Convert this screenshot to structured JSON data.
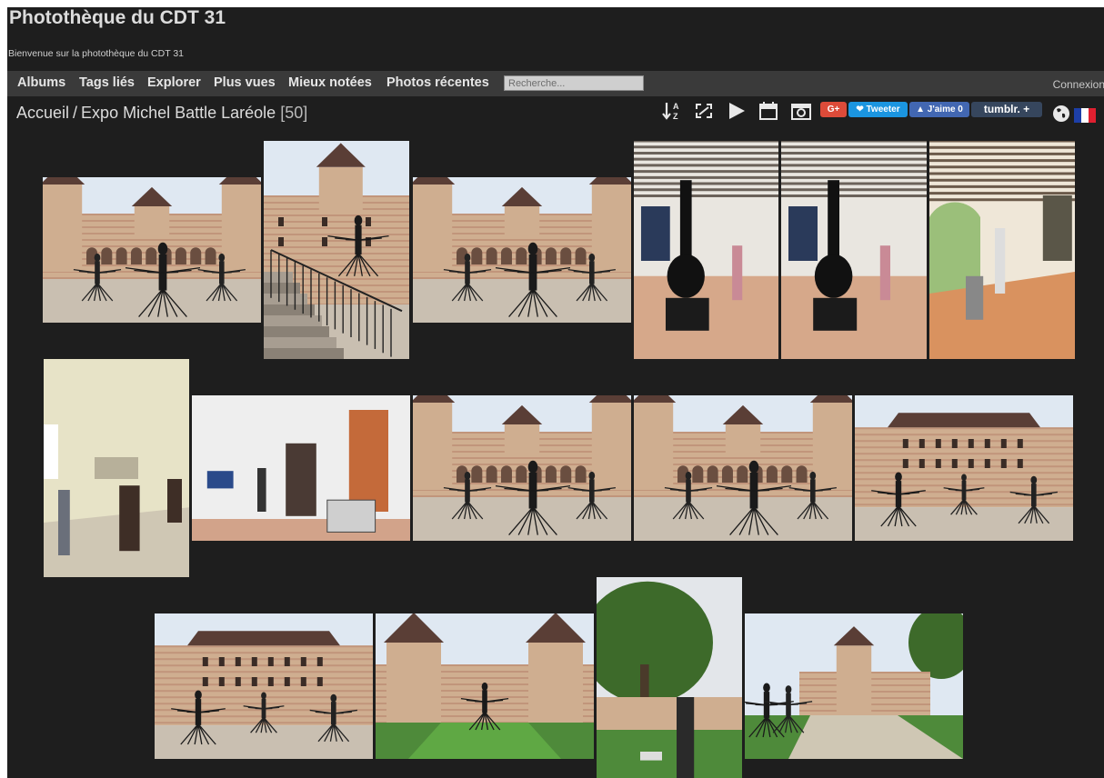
{
  "site": {
    "title": "Photothèque du CDT 31",
    "subtitle": "Bienvenue sur la photothèque du CDT 31"
  },
  "menu": {
    "items": [
      "Albums",
      "Tags liés",
      "Explorer",
      "Plus vues",
      "Mieux notées",
      "Photos récentes"
    ],
    "search_placeholder": "Recherche...",
    "login": "Connexion"
  },
  "breadcrumb": {
    "home": "Accueil",
    "separator": "/",
    "album": "Expo Michel Battle Laréole",
    "count": "[50]"
  },
  "toolbar": {
    "icons": [
      "sort-az-icon",
      "fullscreen-icon",
      "slideshow-play-icon",
      "calendar-icon",
      "camera-icon"
    ],
    "gplus_label": "G+",
    "tweet_label": "Tweeter",
    "like_label": "J'aime 0",
    "tumblr_label": "tumblr. +",
    "language": "Français"
  },
  "colors": {
    "background": "#1e1e1e",
    "menubar": "#3a3a3a",
    "text": "#dcdcdc",
    "gplus": "#dd4b39",
    "twitter": "#1b95e0",
    "facebook": "#4267b2",
    "tumblr": "#36465d"
  },
  "gallery": {
    "thumbnails": [
      {
        "kind": "courtyard"
      },
      {
        "kind": "stairs"
      },
      {
        "kind": "courtyard"
      },
      {
        "kind": "gallery-guitar"
      },
      {
        "kind": "gallery-guitar"
      },
      {
        "kind": "arcade"
      },
      {
        "kind": "hall"
      },
      {
        "kind": "exhibit-room"
      },
      {
        "kind": "courtyard"
      },
      {
        "kind": "courtyard"
      },
      {
        "kind": "facade"
      },
      {
        "kind": "facade"
      },
      {
        "kind": "chateau-lawn"
      },
      {
        "kind": "tree-statue"
      },
      {
        "kind": "chateau-side"
      }
    ]
  }
}
